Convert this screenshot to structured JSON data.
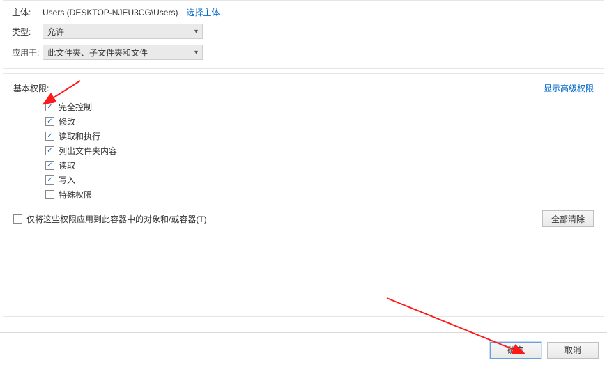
{
  "header": {
    "principal_label": "主体:",
    "principal_value": "Users (DESKTOP-NJEU3CG\\Users)",
    "select_principal_link": "选择主体",
    "type_label": "类型:",
    "type_value": "允许",
    "applies_label": "应用于:",
    "applies_value": "此文件夹、子文件夹和文件"
  },
  "permissions": {
    "basic_label": "基本权限:",
    "show_advanced": "显示高级权限",
    "items": [
      {
        "label": "完全控制",
        "checked": true
      },
      {
        "label": "修改",
        "checked": true
      },
      {
        "label": "读取和执行",
        "checked": true
      },
      {
        "label": "列出文件夹内容",
        "checked": true
      },
      {
        "label": "读取",
        "checked": true
      },
      {
        "label": "写入",
        "checked": true
      },
      {
        "label": "特殊权限",
        "checked": false
      }
    ],
    "apply_only_label": "仅将这些权限应用到此容器中的对象和/或容器(T)",
    "apply_only_checked": false,
    "clear_all": "全部清除"
  },
  "footer": {
    "ok": "确定",
    "cancel": "取消"
  }
}
